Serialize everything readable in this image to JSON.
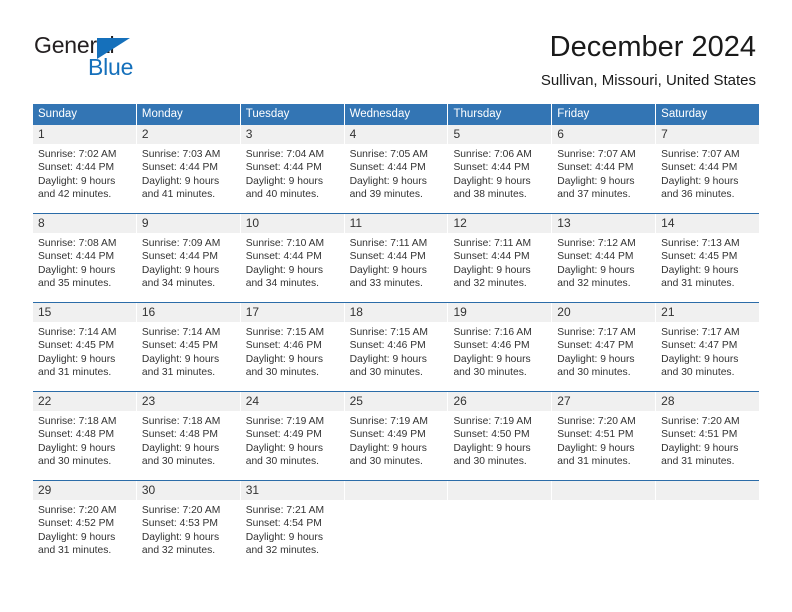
{
  "logo": {
    "word1": "General",
    "word2": "Blue",
    "triangle_color": "#1570bb"
  },
  "header": {
    "title": "December 2024",
    "subtitle": "Sullivan, Missouri, United States"
  },
  "theme": {
    "header_blue": "#3375b4",
    "rule_blue": "#2b6ca8",
    "daynum_bg": "#f0f0f0",
    "text": "#333333"
  },
  "weekdays": [
    "Sunday",
    "Monday",
    "Tuesday",
    "Wednesday",
    "Thursday",
    "Friday",
    "Saturday"
  ],
  "weeks": [
    [
      {
        "day": "1",
        "sunrise": "Sunrise: 7:02 AM",
        "sunset": "Sunset: 4:44 PM",
        "daylight1": "Daylight: 9 hours",
        "daylight2": "and 42 minutes."
      },
      {
        "day": "2",
        "sunrise": "Sunrise: 7:03 AM",
        "sunset": "Sunset: 4:44 PM",
        "daylight1": "Daylight: 9 hours",
        "daylight2": "and 41 minutes."
      },
      {
        "day": "3",
        "sunrise": "Sunrise: 7:04 AM",
        "sunset": "Sunset: 4:44 PM",
        "daylight1": "Daylight: 9 hours",
        "daylight2": "and 40 minutes."
      },
      {
        "day": "4",
        "sunrise": "Sunrise: 7:05 AM",
        "sunset": "Sunset: 4:44 PM",
        "daylight1": "Daylight: 9 hours",
        "daylight2": "and 39 minutes."
      },
      {
        "day": "5",
        "sunrise": "Sunrise: 7:06 AM",
        "sunset": "Sunset: 4:44 PM",
        "daylight1": "Daylight: 9 hours",
        "daylight2": "and 38 minutes."
      },
      {
        "day": "6",
        "sunrise": "Sunrise: 7:07 AM",
        "sunset": "Sunset: 4:44 PM",
        "daylight1": "Daylight: 9 hours",
        "daylight2": "and 37 minutes."
      },
      {
        "day": "7",
        "sunrise": "Sunrise: 7:07 AM",
        "sunset": "Sunset: 4:44 PM",
        "daylight1": "Daylight: 9 hours",
        "daylight2": "and 36 minutes."
      }
    ],
    [
      {
        "day": "8",
        "sunrise": "Sunrise: 7:08 AM",
        "sunset": "Sunset: 4:44 PM",
        "daylight1": "Daylight: 9 hours",
        "daylight2": "and 35 minutes."
      },
      {
        "day": "9",
        "sunrise": "Sunrise: 7:09 AM",
        "sunset": "Sunset: 4:44 PM",
        "daylight1": "Daylight: 9 hours",
        "daylight2": "and 34 minutes."
      },
      {
        "day": "10",
        "sunrise": "Sunrise: 7:10 AM",
        "sunset": "Sunset: 4:44 PM",
        "daylight1": "Daylight: 9 hours",
        "daylight2": "and 34 minutes."
      },
      {
        "day": "11",
        "sunrise": "Sunrise: 7:11 AM",
        "sunset": "Sunset: 4:44 PM",
        "daylight1": "Daylight: 9 hours",
        "daylight2": "and 33 minutes."
      },
      {
        "day": "12",
        "sunrise": "Sunrise: 7:11 AM",
        "sunset": "Sunset: 4:44 PM",
        "daylight1": "Daylight: 9 hours",
        "daylight2": "and 32 minutes."
      },
      {
        "day": "13",
        "sunrise": "Sunrise: 7:12 AM",
        "sunset": "Sunset: 4:44 PM",
        "daylight1": "Daylight: 9 hours",
        "daylight2": "and 32 minutes."
      },
      {
        "day": "14",
        "sunrise": "Sunrise: 7:13 AM",
        "sunset": "Sunset: 4:45 PM",
        "daylight1": "Daylight: 9 hours",
        "daylight2": "and 31 minutes."
      }
    ],
    [
      {
        "day": "15",
        "sunrise": "Sunrise: 7:14 AM",
        "sunset": "Sunset: 4:45 PM",
        "daylight1": "Daylight: 9 hours",
        "daylight2": "and 31 minutes."
      },
      {
        "day": "16",
        "sunrise": "Sunrise: 7:14 AM",
        "sunset": "Sunset: 4:45 PM",
        "daylight1": "Daylight: 9 hours",
        "daylight2": "and 31 minutes."
      },
      {
        "day": "17",
        "sunrise": "Sunrise: 7:15 AM",
        "sunset": "Sunset: 4:46 PM",
        "daylight1": "Daylight: 9 hours",
        "daylight2": "and 30 minutes."
      },
      {
        "day": "18",
        "sunrise": "Sunrise: 7:15 AM",
        "sunset": "Sunset: 4:46 PM",
        "daylight1": "Daylight: 9 hours",
        "daylight2": "and 30 minutes."
      },
      {
        "day": "19",
        "sunrise": "Sunrise: 7:16 AM",
        "sunset": "Sunset: 4:46 PM",
        "daylight1": "Daylight: 9 hours",
        "daylight2": "and 30 minutes."
      },
      {
        "day": "20",
        "sunrise": "Sunrise: 7:17 AM",
        "sunset": "Sunset: 4:47 PM",
        "daylight1": "Daylight: 9 hours",
        "daylight2": "and 30 minutes."
      },
      {
        "day": "21",
        "sunrise": "Sunrise: 7:17 AM",
        "sunset": "Sunset: 4:47 PM",
        "daylight1": "Daylight: 9 hours",
        "daylight2": "and 30 minutes."
      }
    ],
    [
      {
        "day": "22",
        "sunrise": "Sunrise: 7:18 AM",
        "sunset": "Sunset: 4:48 PM",
        "daylight1": "Daylight: 9 hours",
        "daylight2": "and 30 minutes."
      },
      {
        "day": "23",
        "sunrise": "Sunrise: 7:18 AM",
        "sunset": "Sunset: 4:48 PM",
        "daylight1": "Daylight: 9 hours",
        "daylight2": "and 30 minutes."
      },
      {
        "day": "24",
        "sunrise": "Sunrise: 7:19 AM",
        "sunset": "Sunset: 4:49 PM",
        "daylight1": "Daylight: 9 hours",
        "daylight2": "and 30 minutes."
      },
      {
        "day": "25",
        "sunrise": "Sunrise: 7:19 AM",
        "sunset": "Sunset: 4:49 PM",
        "daylight1": "Daylight: 9 hours",
        "daylight2": "and 30 minutes."
      },
      {
        "day": "26",
        "sunrise": "Sunrise: 7:19 AM",
        "sunset": "Sunset: 4:50 PM",
        "daylight1": "Daylight: 9 hours",
        "daylight2": "and 30 minutes."
      },
      {
        "day": "27",
        "sunrise": "Sunrise: 7:20 AM",
        "sunset": "Sunset: 4:51 PM",
        "daylight1": "Daylight: 9 hours",
        "daylight2": "and 31 minutes."
      },
      {
        "day": "28",
        "sunrise": "Sunrise: 7:20 AM",
        "sunset": "Sunset: 4:51 PM",
        "daylight1": "Daylight: 9 hours",
        "daylight2": "and 31 minutes."
      }
    ],
    [
      {
        "day": "29",
        "sunrise": "Sunrise: 7:20 AM",
        "sunset": "Sunset: 4:52 PM",
        "daylight1": "Daylight: 9 hours",
        "daylight2": "and 31 minutes."
      },
      {
        "day": "30",
        "sunrise": "Sunrise: 7:20 AM",
        "sunset": "Sunset: 4:53 PM",
        "daylight1": "Daylight: 9 hours",
        "daylight2": "and 32 minutes."
      },
      {
        "day": "31",
        "sunrise": "Sunrise: 7:21 AM",
        "sunset": "Sunset: 4:54 PM",
        "daylight1": "Daylight: 9 hours",
        "daylight2": "and 32 minutes."
      },
      {
        "day": "",
        "sunrise": "",
        "sunset": "",
        "daylight1": "",
        "daylight2": ""
      },
      {
        "day": "",
        "sunrise": "",
        "sunset": "",
        "daylight1": "",
        "daylight2": ""
      },
      {
        "day": "",
        "sunrise": "",
        "sunset": "",
        "daylight1": "",
        "daylight2": ""
      },
      {
        "day": "",
        "sunrise": "",
        "sunset": "",
        "daylight1": "",
        "daylight2": ""
      }
    ]
  ]
}
